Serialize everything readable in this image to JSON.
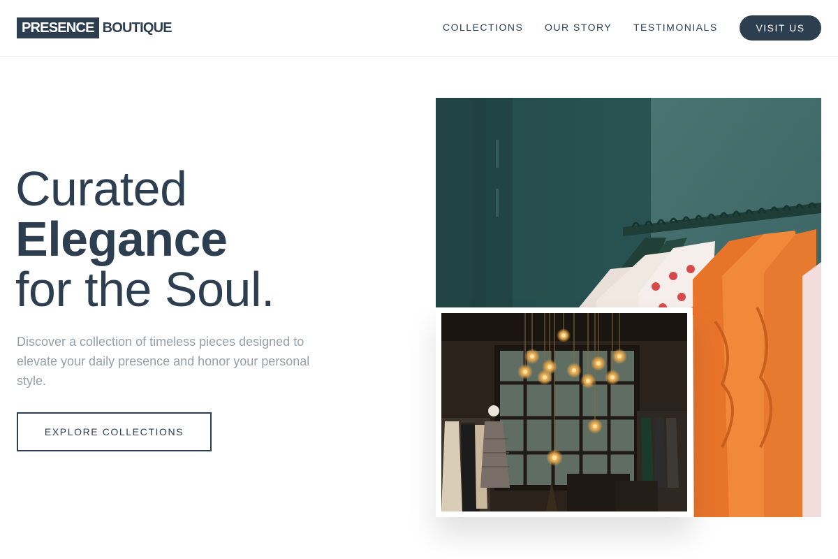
{
  "brand": {
    "highlight": "PRESENCE",
    "rest": "BOUTIQUE"
  },
  "nav": {
    "items": [
      {
        "label": "COLLECTIONS"
      },
      {
        "label": "OUR STORY"
      },
      {
        "label": "TESTIMONIALS"
      }
    ],
    "cta_label": "VISIT US"
  },
  "hero": {
    "title_line1": "Curated",
    "title_line2": "Elegance",
    "title_line3": "for the Soul.",
    "description": "Discover a collection of timeless pieces designed to elevate your daily presence and honor your personal style.",
    "button_label": "EXPLORE COLLECTIONS"
  },
  "images": {
    "main": "clothing-rack-photo",
    "inset": "boutique-interior-photo"
  },
  "colors": {
    "primary": "#2c3e50",
    "muted_text": "#95a0a8",
    "background": "#ffffff"
  }
}
